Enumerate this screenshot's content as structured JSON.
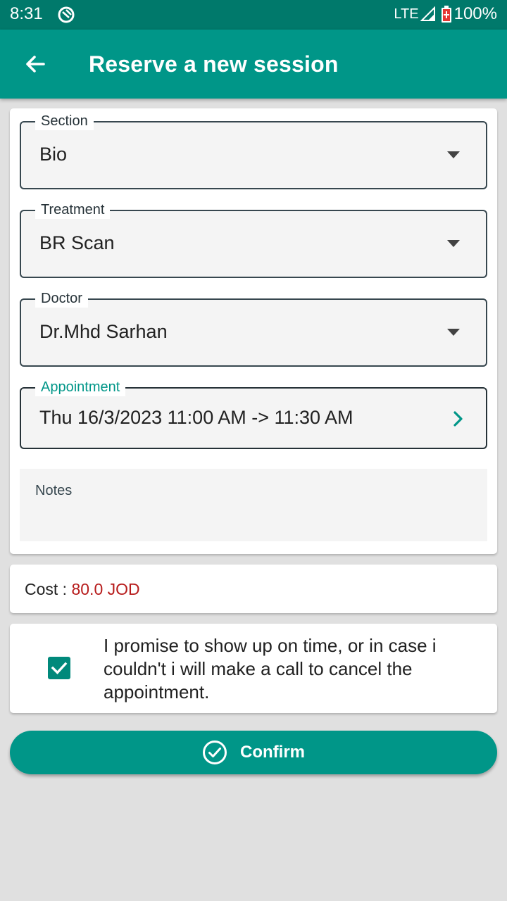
{
  "status_bar": {
    "time": "8:31",
    "network": "LTE",
    "battery": "100%"
  },
  "app_bar": {
    "title": "Reserve a new session",
    "back_icon": "arrow-left-icon"
  },
  "form": {
    "section": {
      "label": "Section",
      "value": "Bio"
    },
    "treatment": {
      "label": "Treatment",
      "value": "BR Scan"
    },
    "doctor": {
      "label": "Doctor",
      "value": "Dr.Mhd Sarhan"
    },
    "appointment": {
      "label": "Appointment",
      "value": "Thu 16/3/2023 11:00 AM -> 11:30 AM"
    },
    "notes": {
      "placeholder": "Notes",
      "value": ""
    }
  },
  "cost": {
    "label": "Cost : ",
    "value": "80.0 JOD"
  },
  "promise": {
    "checked": true,
    "text": "I promise to show up on time, or in case i couldn't i will make a call to cancel the appointment."
  },
  "confirm": {
    "label": "Confirm"
  },
  "colors": {
    "status_bar": "#00796b",
    "app_bar": "#009688",
    "accent": "#009688",
    "cost_value": "#b71c1c",
    "background": "#e0e0e0"
  }
}
